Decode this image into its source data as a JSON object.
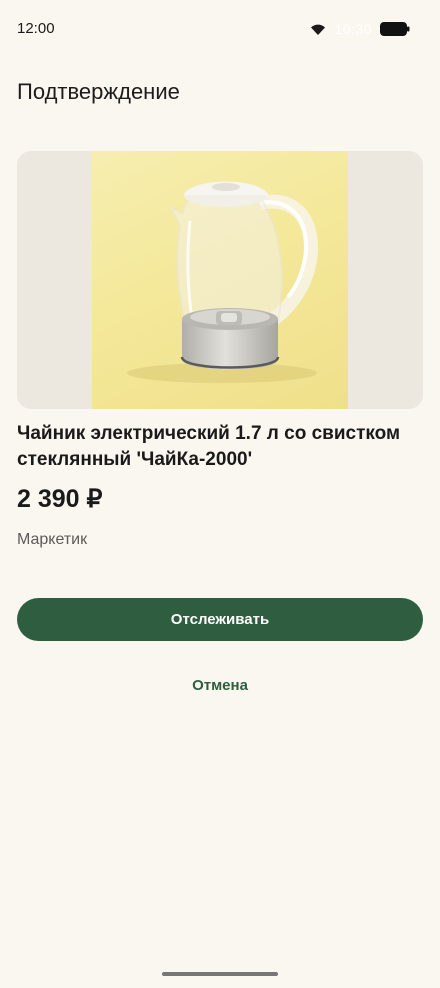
{
  "status_bar": {
    "time": "12:00",
    "clock_overlay": "10:30",
    "icons": [
      "wifi-icon",
      "battery-icon"
    ]
  },
  "page": {
    "title": "Подтверждение"
  },
  "product": {
    "image": "electric-kettle-photo",
    "name": "Чайник электрический 1.7 л со свистком стеклянный 'ЧайКа-2000'",
    "price": "2 390 ₽",
    "seller": "Маркетик"
  },
  "actions": {
    "track_label": "Отслеживать",
    "cancel_label": "Отмена"
  },
  "colors": {
    "background": "#faf7f0",
    "accent": "#2e5e3f"
  }
}
